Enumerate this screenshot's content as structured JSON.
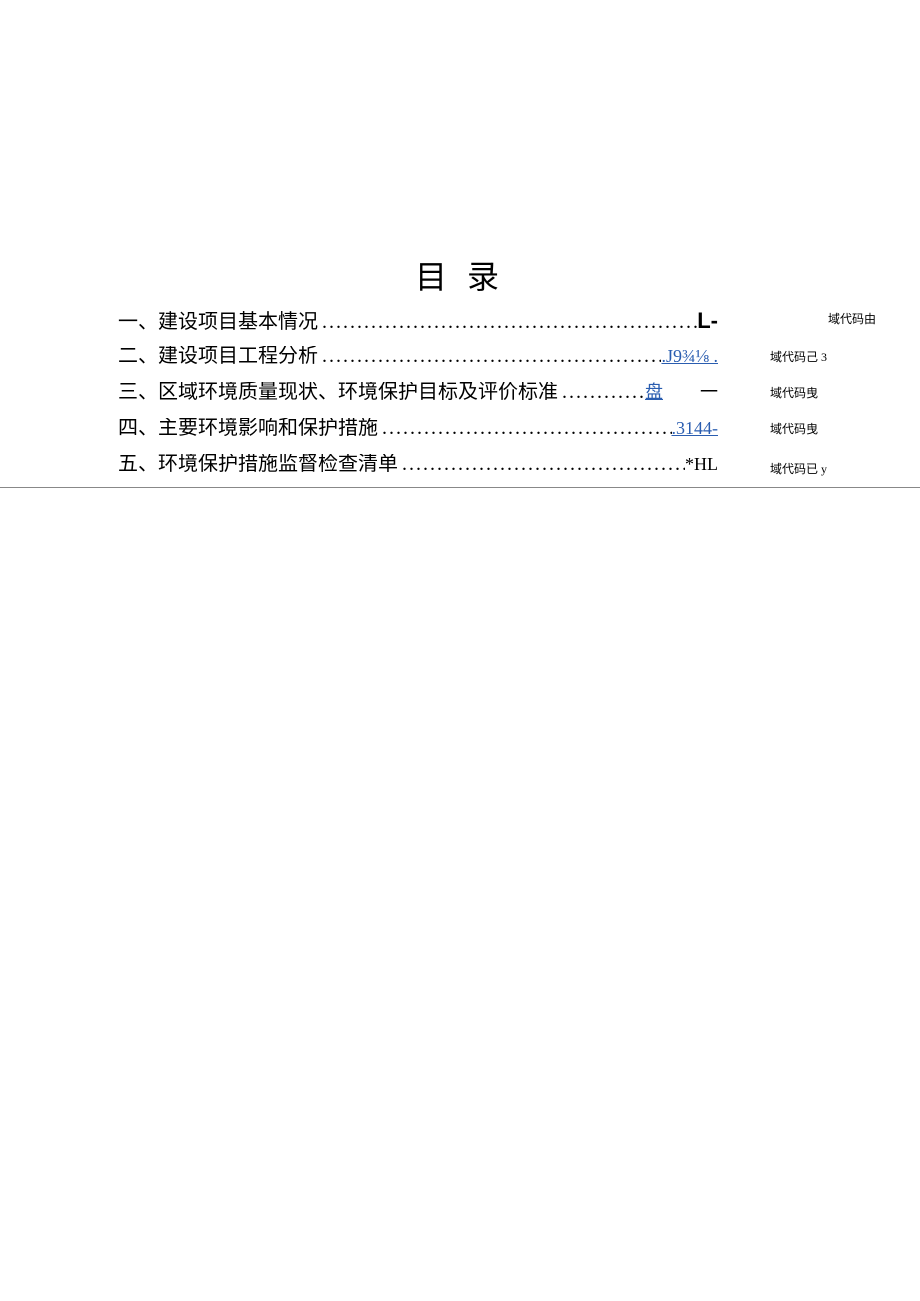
{
  "title": "目 录",
  "toc": {
    "items": [
      {
        "label": "一、建设项目基本情况",
        "page": "L-",
        "side": "域代码由"
      },
      {
        "label": "二、建设项目工程分析",
        "page": ".J9¾⅛ .",
        "side": "域代码己 3"
      },
      {
        "label": "三、区域环境质量现状、环境保护目标及评价标准",
        "page_a": "盘",
        "page_b": "一",
        "side": "域代码曳"
      },
      {
        "label": "四、主要环境影响和保护措施",
        "page": ".3144-",
        "side": "域代码曳"
      },
      {
        "label": "五、环境保护措施监督检查清单",
        "page": "*HL",
        "side": "域代码已 y"
      }
    ]
  }
}
